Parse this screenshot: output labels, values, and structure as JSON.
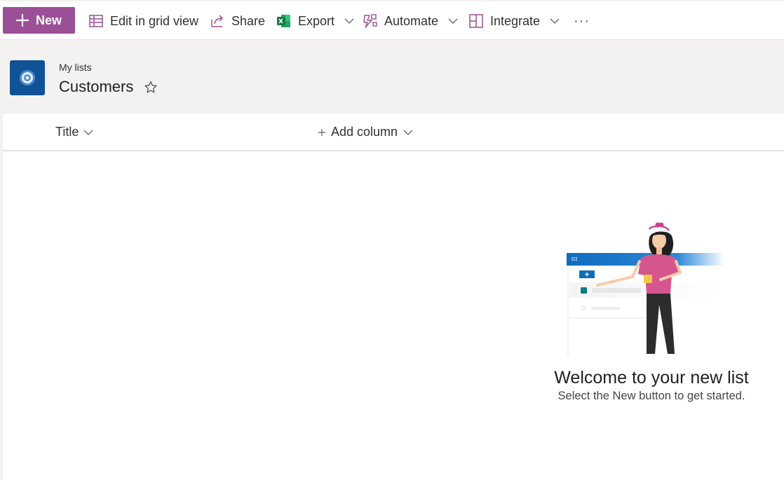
{
  "toolbar": {
    "new_label": "New",
    "edit_grid_label": "Edit in grid view",
    "share_label": "Share",
    "export_label": "Export",
    "automate_label": "Automate",
    "integrate_label": "Integrate",
    "more_label": "···"
  },
  "header": {
    "breadcrumb": "My lists",
    "title": "Customers"
  },
  "list": {
    "columns": [
      {
        "label": "Title"
      },
      {
        "label": "Add column"
      }
    ]
  },
  "empty_state": {
    "title": "Welcome to your new list",
    "subtitle": "Select the New button to get started."
  },
  "colors": {
    "accent": "#9b4f96",
    "site_logo": "#0f5295",
    "excel_green": "#1e7145"
  },
  "icons": [
    "plus-icon",
    "grid-icon",
    "share-icon",
    "excel-icon",
    "automate-icon",
    "integrate-icon",
    "more-icon",
    "star-icon",
    "chevron-down-icon"
  ]
}
